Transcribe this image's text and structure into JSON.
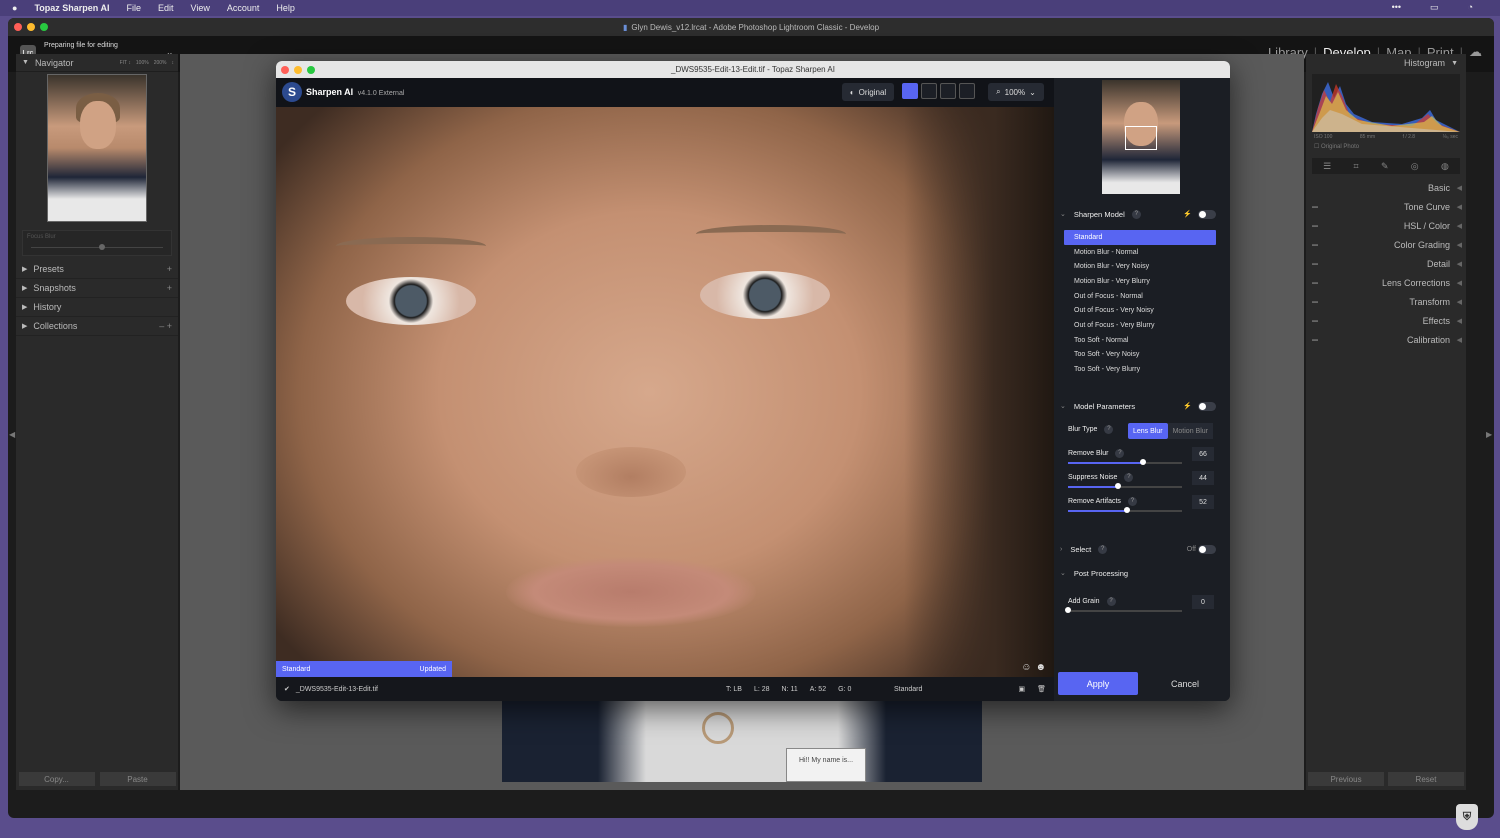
{
  "menubar": {
    "app": "Topaz Sharpen AI",
    "items": [
      "File",
      "Edit",
      "View",
      "Account",
      "Help"
    ],
    "right_icons": [
      "more-icon",
      "control-center-icon",
      "clock-icon"
    ]
  },
  "lr": {
    "title": "Glyn Dewis_v12.lrcat - Adobe Photoshop Lightroom Classic - Develop",
    "logo": "Lrc",
    "preparing": "Preparing file for editing",
    "progress": 0.98,
    "modules": [
      "Library",
      "Develop",
      "Map",
      "Print"
    ],
    "active_module": "Develop",
    "left": {
      "navigator": "Navigator",
      "zoom_options": [
        "FIT ↕",
        "100%",
        "200%",
        "↕"
      ],
      "blur_label": "Focus Blur",
      "items": [
        {
          "label": "Presets",
          "action": "+"
        },
        {
          "label": "Snapshots",
          "action": "+"
        },
        {
          "label": "History",
          "action": ""
        },
        {
          "label": "Collections",
          "action": "– +"
        }
      ],
      "copy": "Copy...",
      "paste": "Paste"
    },
    "right": {
      "histogram": "Histogram",
      "hist_info": [
        "ISO 100",
        "85 mm",
        "f / 2.8",
        "⅛₀ sec"
      ],
      "original_photo": "Original Photo",
      "panels": [
        "Basic",
        "Tone Curve",
        "HSL / Color",
        "Color Grading",
        "Detail",
        "Lens Corrections",
        "Transform",
        "Effects",
        "Calibration"
      ],
      "previous": "Previous",
      "reset": "Reset"
    },
    "bg_tag": "Hi!! My name is..."
  },
  "topaz": {
    "title": "_DWS9535-Edit-13-Edit.tif - Topaz Sharpen AI",
    "logo": "S",
    "app": "Sharpen AI",
    "version": "v4.1.0 External",
    "original": "Original",
    "zoom": "100%",
    "status_model": "Standard",
    "status_state": "Updated",
    "file": "_DWS9535-Edit-13-Edit.tif",
    "stats": [
      "T: LB",
      "L: 28",
      "N: 11",
      "A: 52",
      "G: 0"
    ],
    "footer_model": "Standard",
    "sharpen_model": "Sharpen Model",
    "models": [
      "Standard",
      "Motion Blur - Normal",
      "Motion Blur - Very Noisy",
      "Motion Blur - Very Blurry",
      "Out of Focus - Normal",
      "Out of Focus - Very Noisy",
      "Out of Focus - Very Blurry",
      "Too Soft - Normal",
      "Too Soft - Very Noisy",
      "Too Soft - Very Blurry"
    ],
    "selected_model": "Standard",
    "model_parameters": "Model Parameters",
    "blur_type": "Blur Type",
    "blur_options": [
      "Lens Blur",
      "Motion Blur"
    ],
    "blur_selected": "Lens Blur",
    "params": [
      {
        "label": "Remove Blur",
        "value": "66",
        "pct": 0.66
      },
      {
        "label": "Suppress Noise",
        "value": "44",
        "pct": 0.44
      },
      {
        "label": "Remove Artifacts",
        "value": "52",
        "pct": 0.52
      }
    ],
    "select": "Select",
    "select_state": "Off",
    "post_processing": "Post Processing",
    "add_grain": {
      "label": "Add Grain",
      "value": "0",
      "pct": 0
    },
    "apply": "Apply",
    "cancel": "Cancel",
    "help": "?"
  },
  "colors": {
    "accent": "#5865f2",
    "lr_bg": "#1c1c1c",
    "panel": "#2a2a2a"
  }
}
